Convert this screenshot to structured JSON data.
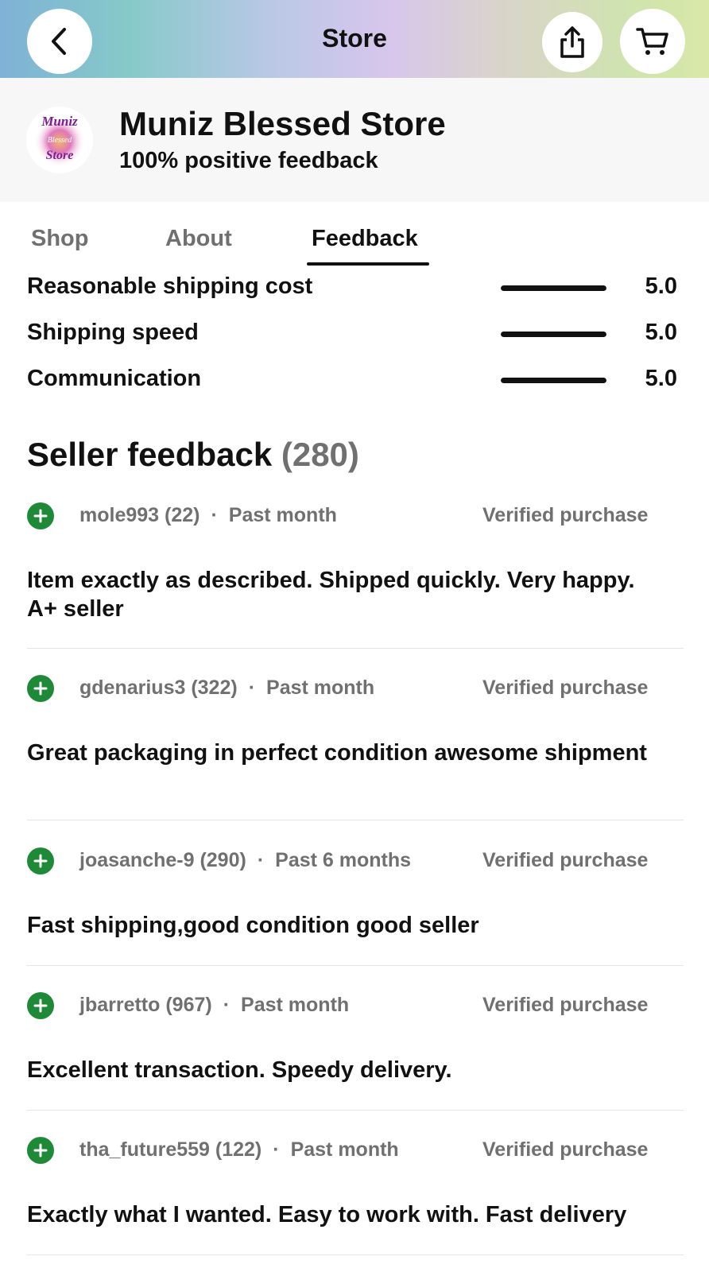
{
  "topbar": {
    "title": "Store"
  },
  "store": {
    "name": "Muniz Blessed Store",
    "feedback_summary": "100% positive feedback",
    "logo_text": [
      "Muniz",
      "Blessed",
      "Store"
    ]
  },
  "tabs": [
    {
      "label": "Shop",
      "active": false
    },
    {
      "label": "About",
      "active": false
    },
    {
      "label": "Feedback",
      "active": true
    }
  ],
  "ratings": [
    {
      "label": "Reasonable shipping cost",
      "value": "5.0",
      "fill": 1.0
    },
    {
      "label": "Shipping speed",
      "value": "5.0",
      "fill": 1.0
    },
    {
      "label": "Communication",
      "value": "5.0",
      "fill": 1.0
    }
  ],
  "seller_feedback": {
    "title": "Seller feedback",
    "count": "(280)",
    "items": [
      {
        "user": "mole993 (22)",
        "time": "Past month",
        "badge": "Verified purchase",
        "text": "Item exactly as described.  Shipped quickly.  Very happy. A+ seller"
      },
      {
        "user": "gdenarius3 (322)",
        "time": "Past month",
        "badge": "Verified purchase",
        "text": "Great packaging in perfect condition awesome shipment"
      },
      {
        "user": "joasanche-9 (290)",
        "time": "Past 6 months",
        "badge": "Verified purchase",
        "text": "Fast shipping,good condition good seller"
      },
      {
        "user": "jbarretto (967)",
        "time": "Past month",
        "badge": "Verified purchase",
        "text": "Excellent transaction. Speedy delivery."
      },
      {
        "user": "tha_future559 (122)",
        "time": "Past month",
        "badge": "Verified purchase",
        "text": "Exactly what I wanted. Easy to work with. Fast delivery"
      }
    ]
  },
  "colors": {
    "positive": "#1e8a38",
    "muted_text": "#707070",
    "header_bg": "#f7f7f7"
  },
  "icons": [
    "chevron-left-icon",
    "share-icon",
    "cart-icon",
    "plus-circle-icon"
  ]
}
